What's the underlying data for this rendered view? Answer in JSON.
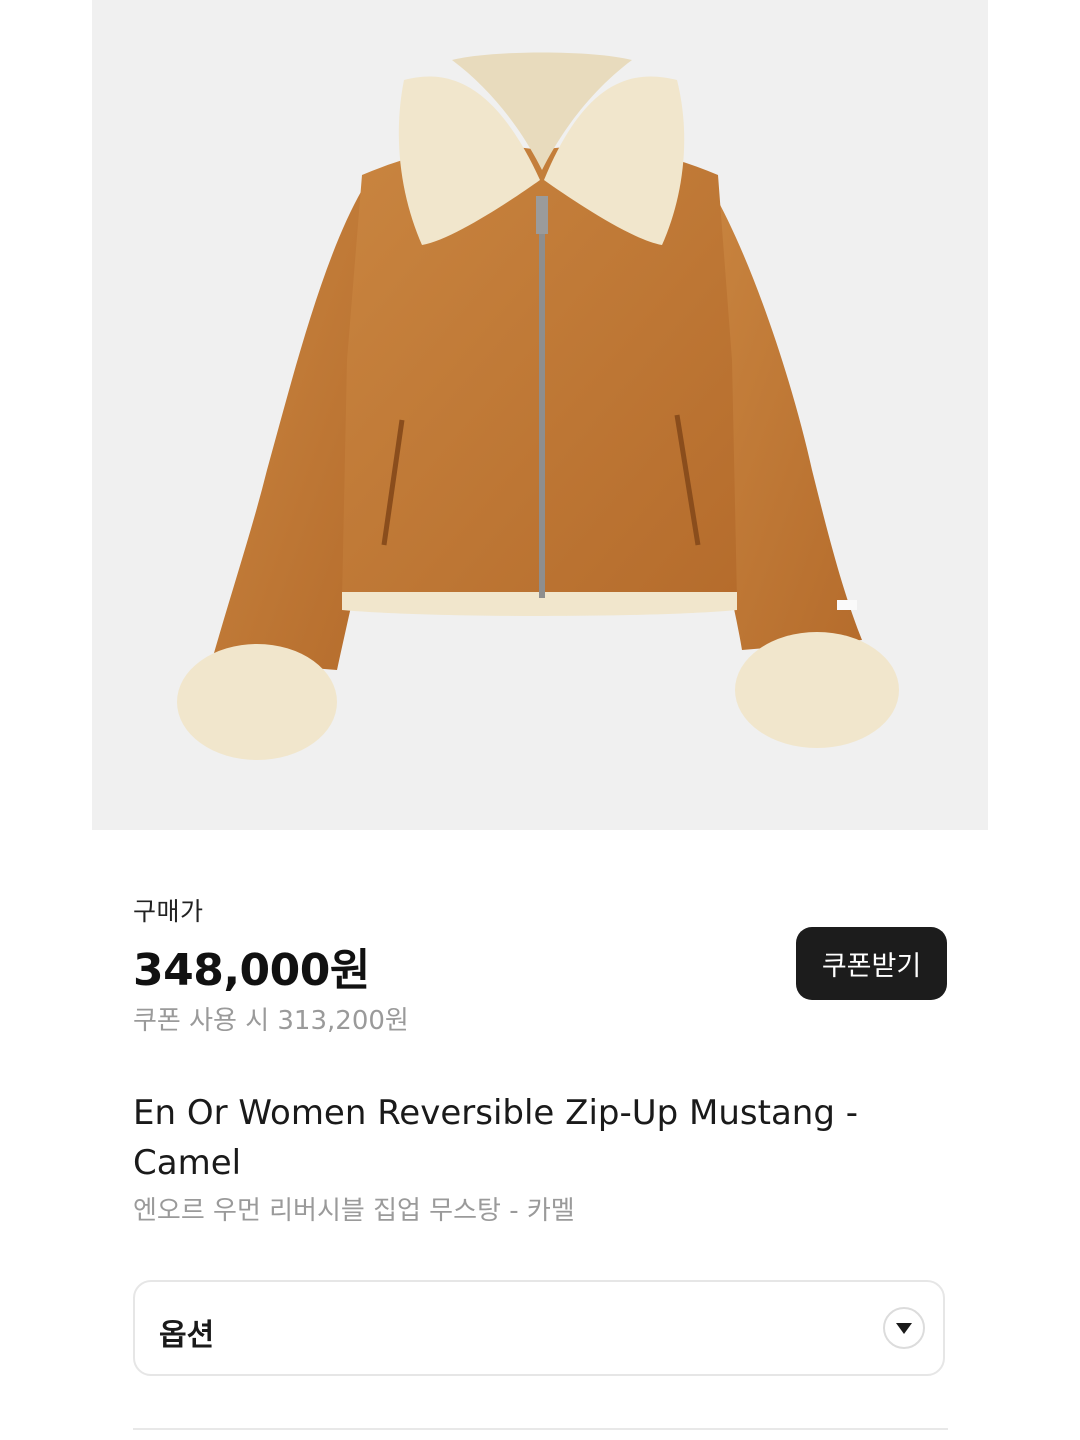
{
  "product": {
    "image_alt": "camel suede jacket with cream shearling collar and cuffs",
    "price_label": "구매가",
    "price": "348,000원",
    "coupon_price": "쿠폰 사용 시 313,200원",
    "coupon_button": "쿠폰받기",
    "title_en": "En Or Women Reversible Zip-Up Mustang - Camel",
    "title_ko": "엔오르 우먼 리버시블 집업 무스탕 - 카멜"
  },
  "option": {
    "label": "옵션",
    "icon": "chevron-down-icon"
  },
  "colors": {
    "jacket": "#c27a37",
    "shearling": "#f1e6cc",
    "button_bg": "#1c1c1c",
    "muted_text": "#9a9a9a"
  }
}
